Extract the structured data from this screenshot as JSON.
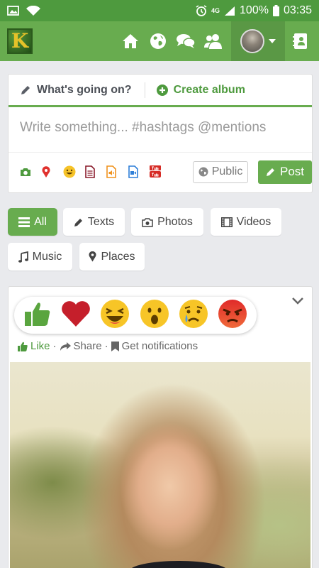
{
  "status_bar": {
    "network": "4G",
    "battery": "100%",
    "time": "03:35"
  },
  "app": {
    "logo_letter": "K"
  },
  "composer": {
    "status_tab": "What's going on?",
    "album_tab": "Create album",
    "placeholder": "Write something... #hashtags @mentions",
    "privacy": "Public",
    "post_label": "Post"
  },
  "filters": {
    "all": "All",
    "texts": "Texts",
    "photos": "Photos",
    "videos": "Videos",
    "music": "Music",
    "places": "Places",
    "active": "All"
  },
  "post": {
    "like": "Like",
    "share": "Share",
    "notifications": "Get notifications",
    "separator": "·"
  },
  "colors": {
    "brand": "#68ac4f",
    "brand_dark": "#4e9a3e",
    "status_bar": "#4e9a3e"
  }
}
